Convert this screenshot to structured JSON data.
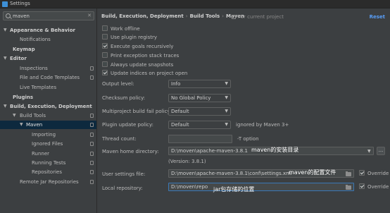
{
  "window": {
    "title": "Settings"
  },
  "search": {
    "value": "maven"
  },
  "sidebar": {
    "items": [
      {
        "label": "Appearance & Behavior"
      },
      {
        "label": "Notifications"
      },
      {
        "label": "Keymap"
      },
      {
        "label": "Editor"
      },
      {
        "label": "Inspections"
      },
      {
        "label": "File and Code Templates"
      },
      {
        "label": "Live Templates"
      },
      {
        "label": "Plugins"
      },
      {
        "label": "Build, Execution, Deployment"
      },
      {
        "label": "Build Tools"
      },
      {
        "label": "Maven"
      },
      {
        "label": "Importing"
      },
      {
        "label": "Ignored Files"
      },
      {
        "label": "Runner"
      },
      {
        "label": "Running Tests"
      },
      {
        "label": "Repositories"
      },
      {
        "label": "Remote Jar Repositories"
      }
    ]
  },
  "header": {
    "breadcrumb": [
      "Build, Execution, Deployment",
      "Build Tools",
      "Maven"
    ],
    "for_project": "For current project",
    "reset": "Reset"
  },
  "options": [
    {
      "label": "Work offline",
      "checked": false
    },
    {
      "label": "Use plugin registry",
      "checked": false
    },
    {
      "label": "Execute goals recursively",
      "checked": true
    },
    {
      "label": "Print exception stack traces",
      "checked": false
    },
    {
      "label": "Always update snapshots",
      "checked": false
    },
    {
      "label": "Update indices on project open",
      "checked": true
    }
  ],
  "fields": {
    "output_level": {
      "label": "Output level:",
      "value": "Info"
    },
    "checksum_policy": {
      "label": "Checksum policy:",
      "value": "No Global Policy"
    },
    "multiproject_fail": {
      "label": "Multiproject build fail policy:",
      "value": "Default"
    },
    "plugin_update": {
      "label": "Plugin update policy:",
      "value": "Default",
      "hint": "ignored by Maven 3+"
    },
    "thread_count": {
      "label": "Thread count:",
      "value": "",
      "hint": "-T option"
    },
    "maven_home": {
      "label": "Maven home directory:",
      "value": "D:\\moven\\apache-maven-3.8.1",
      "version": "(Version: 3.8.1)",
      "more": "..."
    },
    "user_settings": {
      "label": "User settings file:",
      "value": "D:\\moven\\apache-maven-3.8.1\\conf\\settings.xml",
      "override_label": "Override",
      "override": true
    },
    "local_repo": {
      "label": "Local repository:",
      "value": "D:\\moven\\repo",
      "override_label": "Override",
      "override": true
    }
  },
  "annotations": {
    "home": "maven的安装目录",
    "settings": "maven的配置文件",
    "repo": "jar包存储的位置"
  }
}
